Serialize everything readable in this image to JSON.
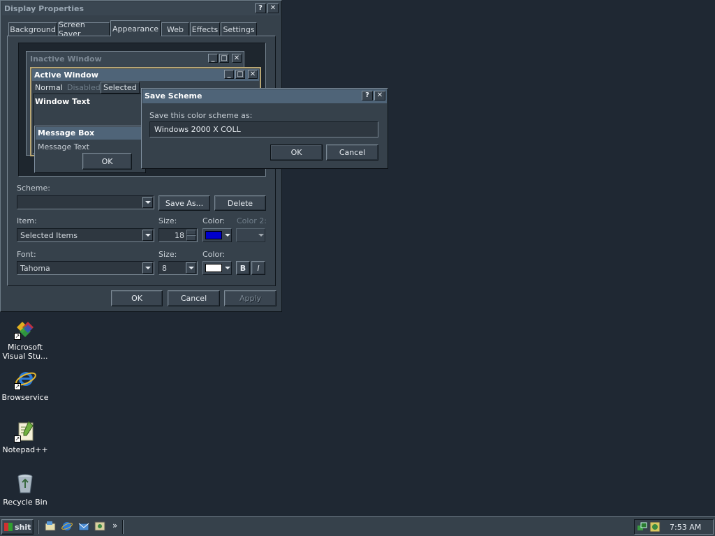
{
  "display_properties": {
    "title": "Display Properties",
    "tabs": [
      "Background",
      "Screen Saver",
      "Appearance",
      "Web",
      "Effects",
      "Settings"
    ],
    "active_tab": "Appearance",
    "preview": {
      "inactive_title": "Inactive Window",
      "active_title": "Active Window",
      "menu": [
        "Normal",
        "Disabled",
        "Selected"
      ],
      "window_text": "Window Text",
      "msgbox_title": "Message Box",
      "msgbox_text": "Message Text",
      "msgbox_ok": "OK"
    },
    "scheme_label": "Scheme:",
    "scheme_value": "",
    "save_as": "Save As...",
    "delete": "Delete",
    "item_label": "Item:",
    "item_value": "Selected Items",
    "item_size_label": "Size:",
    "item_size_value": "18",
    "color_label": "Color:",
    "color1": "#0000cc",
    "color2_label": "Color 2:",
    "font_label": "Font:",
    "font_value": "Tahoma",
    "font_size_label": "Size:",
    "font_size_value": "8",
    "font_color_label": "Color:",
    "font_color": "#ffffff",
    "bold": "B",
    "italic": "I",
    "ok": "OK",
    "cancel": "Cancel",
    "apply": "Apply"
  },
  "save_scheme": {
    "title": "Save Scheme",
    "prompt": "Save this color scheme as:",
    "value": "Windows 2000 X COLL",
    "ok": "OK",
    "cancel": "Cancel"
  },
  "desktop_icons": [
    {
      "label1": "Microsoft",
      "label2": "Visual Stu...",
      "icon": "visual-studio-icon"
    },
    {
      "label1": "Browservice",
      "label2": "",
      "icon": "internet-explorer-icon"
    },
    {
      "label1": "Notepad++",
      "label2": "",
      "icon": "notepad-plus-plus-icon"
    },
    {
      "label1": "Recycle Bin",
      "label2": "",
      "icon": "recycle-bin-icon"
    }
  ],
  "taskbar": {
    "start_label": "shit",
    "chevron": "»",
    "clock": "7:53 AM"
  },
  "title_buttons": {
    "help": "?",
    "close": "✕"
  }
}
